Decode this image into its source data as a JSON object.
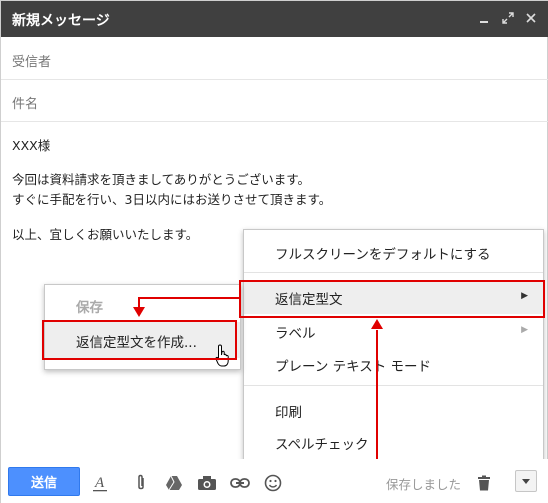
{
  "window": {
    "title": "新規メッセージ",
    "controls": [
      "minimize-icon",
      "expand-icon",
      "close-icon"
    ]
  },
  "fields": {
    "to_placeholder": "受信者",
    "subject_placeholder": "件名"
  },
  "message": {
    "line1": "XXX様",
    "line2": "今回は資料請求を頂きましてありがとうございます。",
    "line3": "すぐに手配を行い、3日以内にはお送りさせて頂きます。",
    "line4": "以上、宜しくお願いいたします。"
  },
  "main_menu": {
    "items": [
      {
        "label": "フルスクリーンをデフォルトにする",
        "has_submenu": false
      },
      {
        "label": "返信定型文",
        "has_submenu": true,
        "highlighted": true
      },
      {
        "label": "ラベル",
        "has_submenu": true
      },
      {
        "label": "プレーン テキスト モード",
        "has_submenu": false
      },
      {
        "label": "印刷",
        "has_submenu": false
      },
      {
        "label": "スペルチェック",
        "has_submenu": false
      }
    ]
  },
  "submenu": {
    "header": "保存",
    "items": [
      {
        "label": "返信定型文を作成...",
        "highlighted": true
      }
    ]
  },
  "toolbar": {
    "send_label": "送信",
    "saved_status": "保存しました",
    "icons": [
      "format-text-icon",
      "attach-icon",
      "drive-icon",
      "camera-icon",
      "link-icon",
      "emoji-icon",
      "trash-icon",
      "more-options-icon"
    ]
  },
  "colors": {
    "titlebar": "#404040",
    "send_button": "#4d90fe",
    "annotation": "#e00000",
    "highlight": "#eeeeee"
  }
}
